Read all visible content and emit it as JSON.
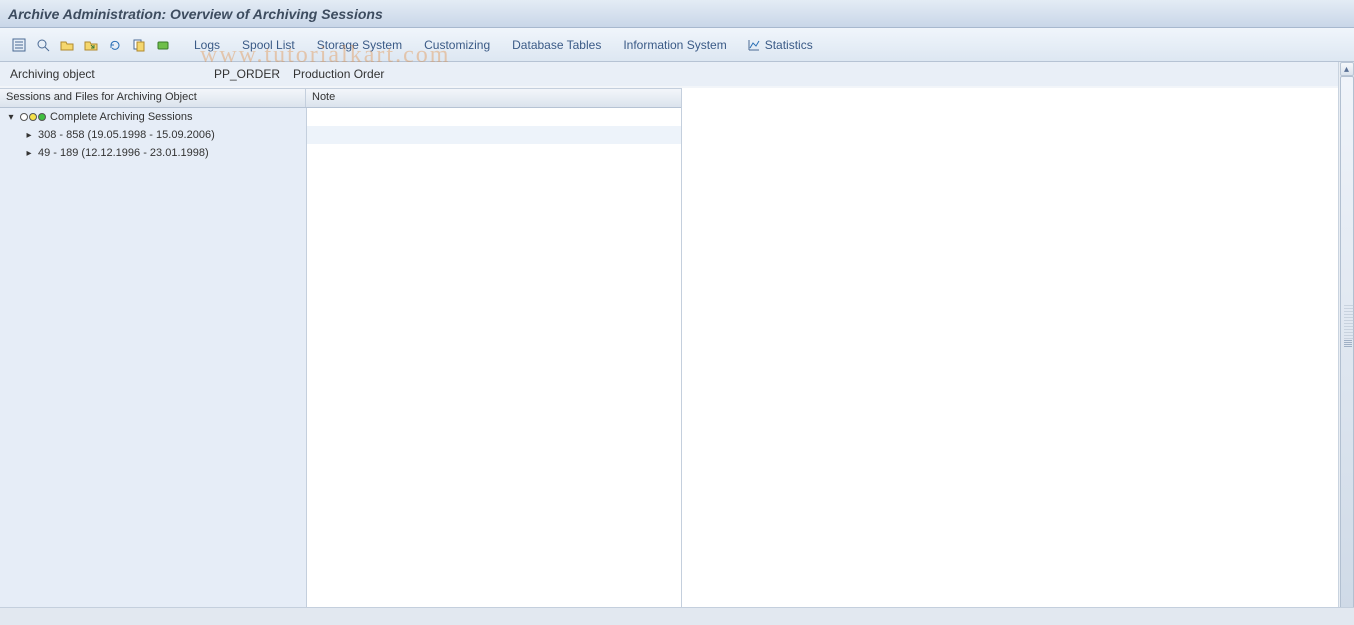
{
  "title": "Archive Administration: Overview of Archiving Sessions",
  "toolbar": {
    "links": {
      "logs": "Logs",
      "spool": "Spool List",
      "storage": "Storage System",
      "custom": "Customizing",
      "dbtables": "Database Tables",
      "infosys": "Information System",
      "stats": "Statistics"
    }
  },
  "context": {
    "label": "Archiving object",
    "code": "PP_ORDER",
    "desc": "Production Order"
  },
  "table": {
    "headers": {
      "sessions": "Sessions and Files for Archiving Object",
      "note": "Note"
    },
    "root": {
      "label": "Complete Archiving Sessions",
      "expanded": true
    },
    "rows": [
      {
        "label": "308 - 858 (19.05.1998 - 15.09.2006)",
        "note": ""
      },
      {
        "label": "49 - 189 (12.12.1996 - 23.01.1998)",
        "note": ""
      }
    ]
  },
  "watermark": "www.tutorialkart.com"
}
